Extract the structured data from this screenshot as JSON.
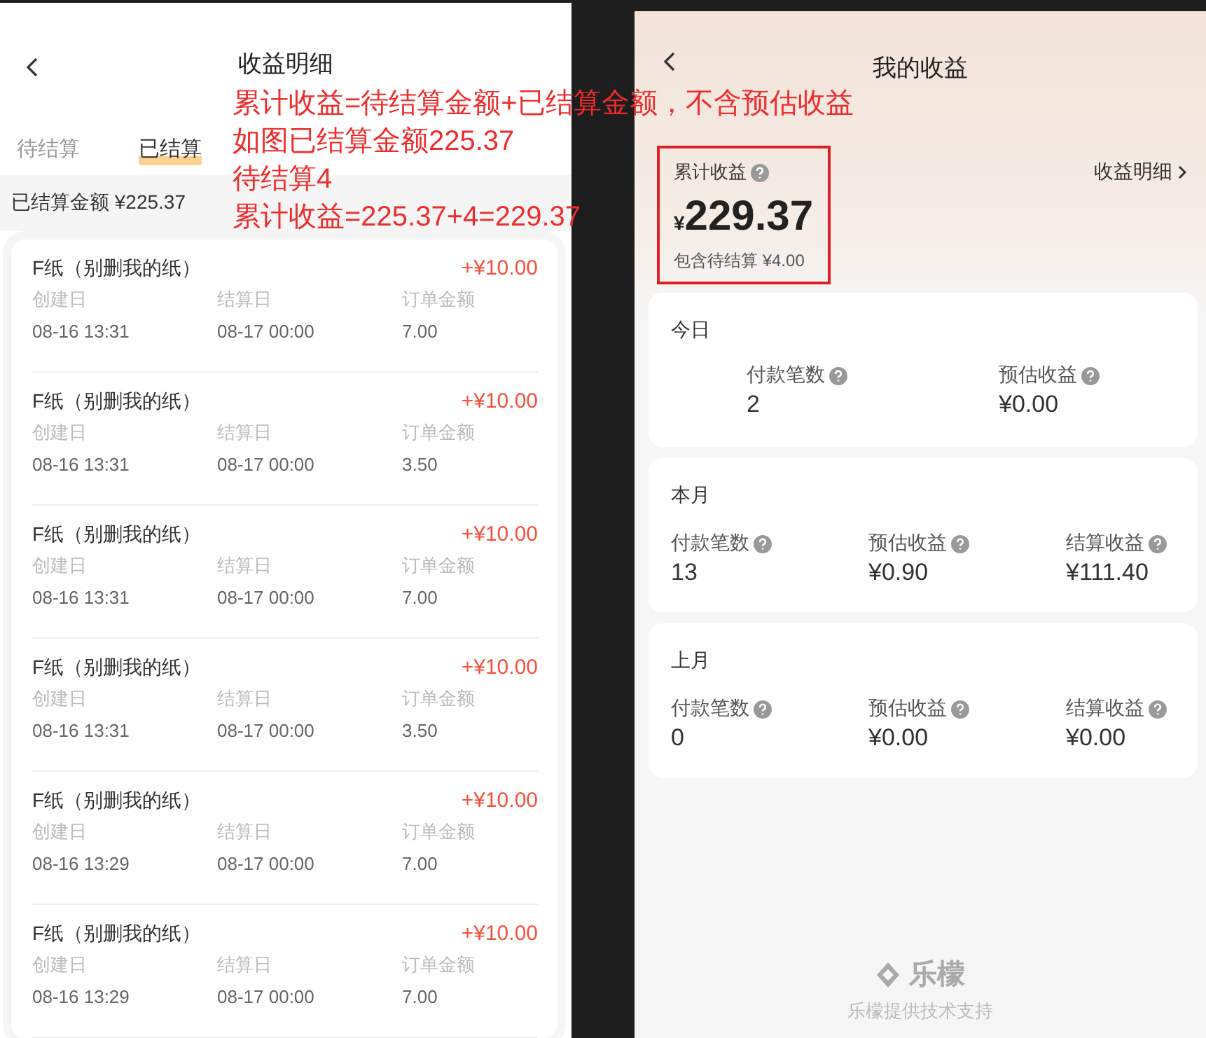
{
  "detail_screen": {
    "title": "收益明细",
    "tabs": [
      {
        "label": "待结算",
        "selected": false
      },
      {
        "label": "已结算",
        "selected": true
      }
    ],
    "summary": "已结算金额 ¥225.37",
    "records": [
      {
        "name": "F纸（别删我的纸）",
        "amount": "+¥10.00",
        "fields": [
          {
            "label": "创建日",
            "value": "08-16 13:31"
          },
          {
            "label": "结算日",
            "value": "08-17 00:00"
          },
          {
            "label": "订单金额",
            "value": "7.00"
          }
        ]
      },
      {
        "name": "F纸（别删我的纸）",
        "amount": "+¥10.00",
        "fields": [
          {
            "label": "创建日",
            "value": "08-16 13:31"
          },
          {
            "label": "结算日",
            "value": "08-17 00:00"
          },
          {
            "label": "订单金额",
            "value": "3.50"
          }
        ]
      },
      {
        "name": "F纸（别删我的纸）",
        "amount": "+¥10.00",
        "fields": [
          {
            "label": "创建日",
            "value": "08-16 13:31"
          },
          {
            "label": "结算日",
            "value": "08-17 00:00"
          },
          {
            "label": "订单金额",
            "value": "7.00"
          }
        ]
      },
      {
        "name": "F纸（别删我的纸）",
        "amount": "+¥10.00",
        "fields": [
          {
            "label": "创建日",
            "value": "08-16 13:31"
          },
          {
            "label": "结算日",
            "value": "08-17 00:00"
          },
          {
            "label": "订单金额",
            "value": "3.50"
          }
        ]
      },
      {
        "name": "F纸（别删我的纸）",
        "amount": "+¥10.00",
        "fields": [
          {
            "label": "创建日",
            "value": "08-16 13:29"
          },
          {
            "label": "结算日",
            "value": "08-17 00:00"
          },
          {
            "label": "订单金额",
            "value": "7.00"
          }
        ]
      },
      {
        "name": "F纸（别删我的纸）",
        "amount": "+¥10.00",
        "fields": [
          {
            "label": "创建日",
            "value": "08-16 13:29"
          },
          {
            "label": "结算日",
            "value": "08-17 00:00"
          },
          {
            "label": "订单金额",
            "value": "7.00"
          }
        ]
      }
    ]
  },
  "annotation": {
    "lines": [
      "累计收益=待结算金额+已结算金额，不含预估收益",
      "如图已结算金额225.37",
      "待结算4",
      "累计收益=225.37+4=229.37"
    ]
  },
  "earnings_screen": {
    "title": "我的收益",
    "total": {
      "label": "累计收益",
      "currency": "¥",
      "amount": "229.37",
      "note": "包含待结算 ¥4.00",
      "highlighted": true
    },
    "detail_link": "收益明细",
    "periods": [
      {
        "title": "今日",
        "stats": [
          {
            "label": "付款笔数",
            "value": "2"
          },
          {
            "label": "预估收益",
            "value": "¥0.00"
          }
        ]
      },
      {
        "title": "本月",
        "stats": [
          {
            "label": "付款笔数",
            "value": "13"
          },
          {
            "label": "预估收益",
            "value": "¥0.90"
          },
          {
            "label": "结算收益",
            "value": "¥111.40"
          }
        ]
      },
      {
        "title": "上月",
        "stats": [
          {
            "label": "付款笔数",
            "value": "0"
          },
          {
            "label": "预估收益",
            "value": "¥0.00"
          },
          {
            "label": "结算收益",
            "value": "¥0.00"
          }
        ]
      }
    ],
    "footer": {
      "brand": "乐檬",
      "credit": "乐檬提供技术支持"
    }
  }
}
